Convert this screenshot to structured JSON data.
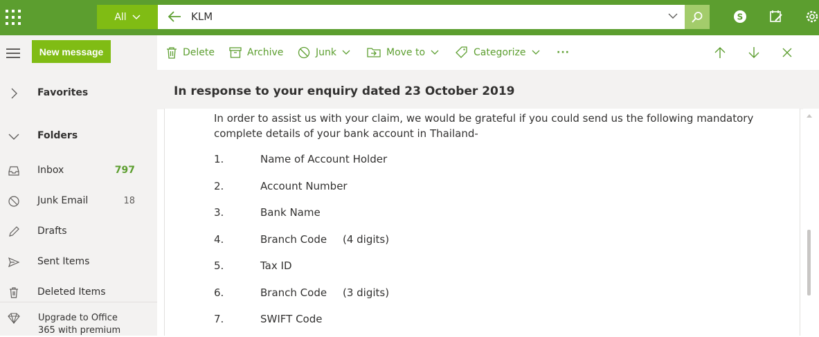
{
  "topbar": {
    "scope_label": "All",
    "search_value": "KLM",
    "icons": [
      "app-launcher-icon",
      "back-arrow-icon",
      "dropdown-chevron-icon",
      "search-icon",
      "skype-icon",
      "my-day-icon",
      "settings-gear-icon"
    ]
  },
  "toolbar": {
    "new_message": "New message",
    "delete": "Delete",
    "archive": "Archive",
    "junk": "Junk",
    "move_to": "Move to",
    "categorize": "Categorize",
    "more": "···"
  },
  "sidebar": {
    "favorites": "Favorites",
    "folders": "Folders",
    "items": [
      {
        "label": "Inbox",
        "count": "797",
        "icon": "inbox-icon"
      },
      {
        "label": "Junk Email",
        "count": "18",
        "icon": "junk-icon"
      },
      {
        "label": "Drafts",
        "count": "",
        "icon": "pencil-icon"
      },
      {
        "label": "Sent Items",
        "count": "",
        "icon": "send-icon"
      },
      {
        "label": "Deleted Items",
        "count": "",
        "icon": "trash-icon"
      }
    ],
    "upgrade_line1": "Upgrade to Office",
    "upgrade_line2": "365 with premium"
  },
  "message": {
    "subject": "In response to your enquiry dated 23 October 2019",
    "intro": "In order to assist us with your claim, we would be grateful if you could send us the following mandatory complete details of your bank account in Thailand-",
    "list": [
      {
        "num": "1.",
        "item": "Name of Account Holder",
        "note": ""
      },
      {
        "num": "2.",
        "item": "Account Number",
        "note": ""
      },
      {
        "num": "3.",
        "item": "Bank Name",
        "note": ""
      },
      {
        "num": "4.",
        "item": "Branch Code",
        "note": "(4 digits)"
      },
      {
        "num": "5.",
        "item": "Tax ID",
        "note": ""
      },
      {
        "num": "6.",
        "item": "Branch Code",
        "note": "(3 digits)"
      },
      {
        "num": "7.",
        "item": "SWIFT Code",
        "note": ""
      }
    ]
  },
  "colors": {
    "brand_green": "#5c9e2f",
    "accent_green": "#80bc14"
  }
}
